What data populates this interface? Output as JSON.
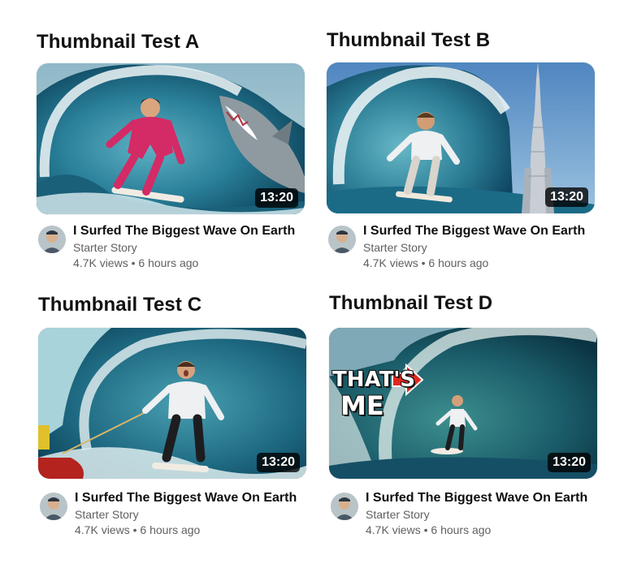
{
  "cards": [
    {
      "heading": "Thumbnail Test A",
      "duration": "13:20",
      "title": "I Surfed The Biggest Wave On Earth",
      "channel": "Starter Story",
      "views": "4.7K views",
      "separator": "•",
      "age": "6 hours ago"
    },
    {
      "heading": "Thumbnail Test B",
      "duration": "13:20",
      "title": "I Surfed The Biggest Wave On Earth",
      "channel": "Starter Story",
      "views": "4.7K views",
      "separator": "•",
      "age": "6 hours ago"
    },
    {
      "heading": "Thumbnail Test C",
      "duration": "13:20",
      "title": "I Surfed The Biggest Wave On Earth",
      "channel": "Starter Story",
      "views": "4.7K views",
      "separator": "•",
      "age": "6 hours ago"
    },
    {
      "heading": "Thumbnail Test D",
      "duration": "13:20",
      "title": "I Surfed The Biggest Wave On Earth",
      "channel": "Starter Story",
      "views": "4.7K views",
      "separator": "•",
      "age": "6 hours ago",
      "overlay_text_line1": "THAT'S",
      "overlay_text_line2": "ME"
    }
  ],
  "colors": {
    "wave_deep": "#0f4f6a",
    "wave_light": "#3a93ad",
    "foam": "#e9f3f4",
    "wetsuit_pink": "#d42a66",
    "arrow_red": "#e0281e"
  }
}
